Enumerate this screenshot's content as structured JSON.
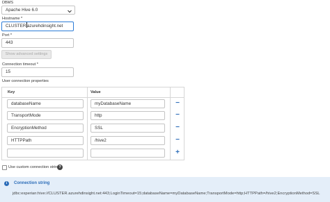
{
  "dbms": {
    "label": "DBMS",
    "value": "Apache Hive 6.0"
  },
  "hostname": {
    "label": "Hostname *",
    "value_before_cursor": "CLUSTER",
    "value_after_cursor": "azurehdinsight.net"
  },
  "port": {
    "label": "Port *",
    "value": "443"
  },
  "advanced_button": {
    "label": "Show advanced settings"
  },
  "connection_timeout": {
    "label": "Connection timeout *",
    "value": "15"
  },
  "user_properties": {
    "label": "User connection properties",
    "columns": [
      "Key",
      "Value"
    ],
    "rows": [
      {
        "key": "databaseName",
        "value": "myDatabaseName",
        "action": "−"
      },
      {
        "key": "TransportMode",
        "value": "http",
        "action": "−"
      },
      {
        "key": "EncryptionMethod",
        "value": "SSL",
        "action": "−"
      },
      {
        "key": "HTTPPath",
        "value": "/hive2",
        "action": "−"
      },
      {
        "key": "",
        "value": "",
        "action": "+"
      }
    ]
  },
  "custom_connection": {
    "label": "Use custom connection string",
    "checked": false,
    "help": "?"
  },
  "connection_string": {
    "title": "Connection string",
    "info": "i",
    "value": "jdbc:experian:hive://CLUSTER.azurehdinsight.net:443;LoginTimeout=15;databaseName=myDatabaseName;TransportMode=http;HTTPPath=/hive2;EncryptionMethod=SSL"
  },
  "colors": {
    "accent": "#2b6cb8",
    "focus_border": "#2b7bd6",
    "info_bg": "#e4eef9",
    "border": "#c4c4c4"
  }
}
